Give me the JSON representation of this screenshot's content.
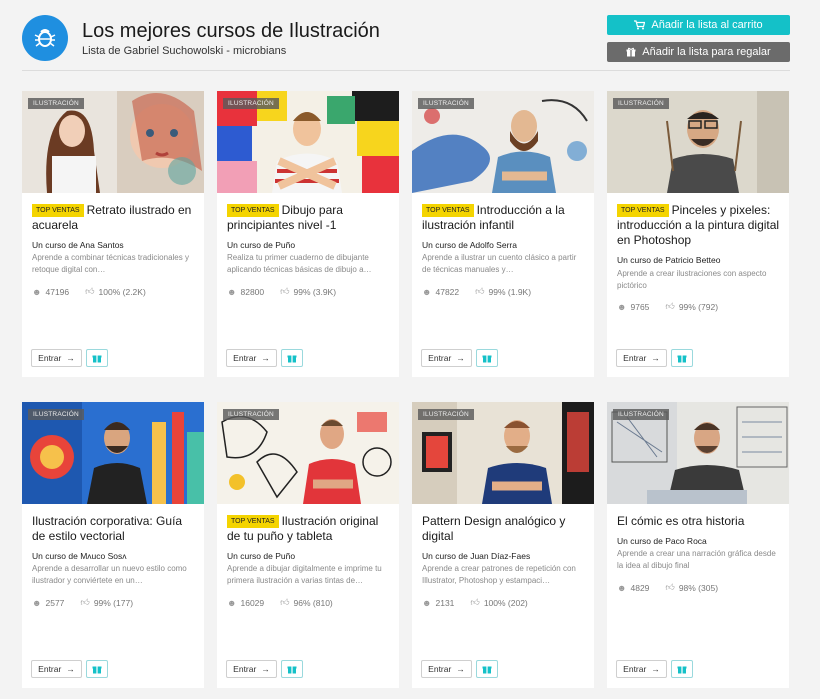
{
  "header": {
    "title": "Los mejores cursos de Ilustración",
    "subtitle": "Lista de Gabriel Suchowolski - microbians",
    "logo_icon": "bug-icon",
    "cart_button": "Añadir la lista al carrito",
    "gift_button": "Añadir la lista para regalar",
    "accent": "#14c1c8"
  },
  "labels": {
    "category": "ILUSTRACIÓN",
    "top": "TOP VENTAS",
    "enter": "Entrar"
  },
  "cards": [
    {
      "title": "Retrato ilustrado en acuarela",
      "top": true,
      "author": "Un curso de Ana Santos",
      "desc": "Aprende a combinar técnicas tradicionales y retoque digital con…",
      "students": "47196",
      "rating": "100% (2.2K)"
    },
    {
      "title": "Dibujo para principiantes nivel -1",
      "top": true,
      "author": "Un curso de Puño",
      "desc": "Realiza tu primer cuaderno de dibujante aplicando técnicas básicas de dibujo a…",
      "students": "82800",
      "rating": "99% (3.9K)"
    },
    {
      "title": "Introducción a la ilustración infantil",
      "top": true,
      "author": "Un curso de Adolfo Serra",
      "desc": "Aprende a ilustrar un cuento clásico a partir de técnicas manuales y…",
      "students": "47822",
      "rating": "99% (1.9K)"
    },
    {
      "title": "Pinceles y pixeles: introducción a la pintura digital en Photoshop",
      "top": true,
      "author": "Un curso de Patricio Betteo",
      "desc": "Aprende a crear ilustraciones con aspecto pictórico",
      "students": "9765",
      "rating": "99% (792)"
    },
    {
      "title": "Ilustración corporativa: Guía de estilo vectorial",
      "top": false,
      "author": "Un curso de Mʌuco Sosʌ",
      "desc": "Aprende a desarrollar un nuevo estilo como ilustrador y conviértete en un…",
      "students": "2577",
      "rating": "99% (177)"
    },
    {
      "title": "Ilustración original de tu puño y tableta",
      "top": true,
      "author": "Un curso de Puño",
      "desc": "Aprende a dibujar digitalmente e imprime tu primera ilustración a varias tintas de…",
      "students": "16029",
      "rating": "96% (810)"
    },
    {
      "title": "Pattern Design analógico y digital",
      "top": false,
      "author": "Un curso de Juan Díaz-Faes",
      "desc": "Aprende a crear patrones de repetición con Illustrator, Photoshop y estampaci…",
      "students": "2131",
      "rating": "100% (202)"
    },
    {
      "title": "El cómic es otra historia",
      "top": false,
      "author": "Un curso de Paco Roca",
      "desc": "Aprende a crear una narración gráfica desde la idea al dibujo final",
      "students": "4829",
      "rating": "98% (305)"
    }
  ]
}
